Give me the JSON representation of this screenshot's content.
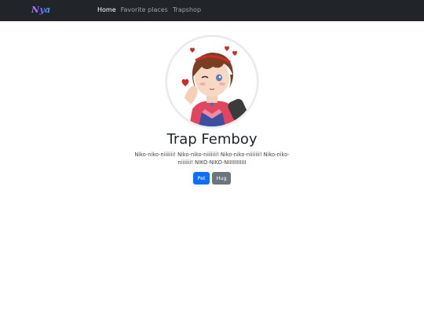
{
  "navbar": {
    "brand": "Nya",
    "links": [
      {
        "label": "Home",
        "active": true
      },
      {
        "label": "Favorite places",
        "active": false
      },
      {
        "label": "Trapshop",
        "active": false
      }
    ]
  },
  "profile": {
    "avatar_icon": "anime-character-avatar",
    "name": "Trap Femboy",
    "description": "Niko-niko-niiiiiii! Niko-niko-niiiiiii! Niko-niko-niiiiiii! Niko-niko-niiiiiii! NIKO-NIKO-NIIIIIIIIIIII"
  },
  "actions": {
    "pet_label": "Pet",
    "hug_label": "Hug"
  },
  "colors": {
    "navbar_bg": "#212529",
    "primary": "#0d6efd",
    "secondary": "#6c757d"
  }
}
